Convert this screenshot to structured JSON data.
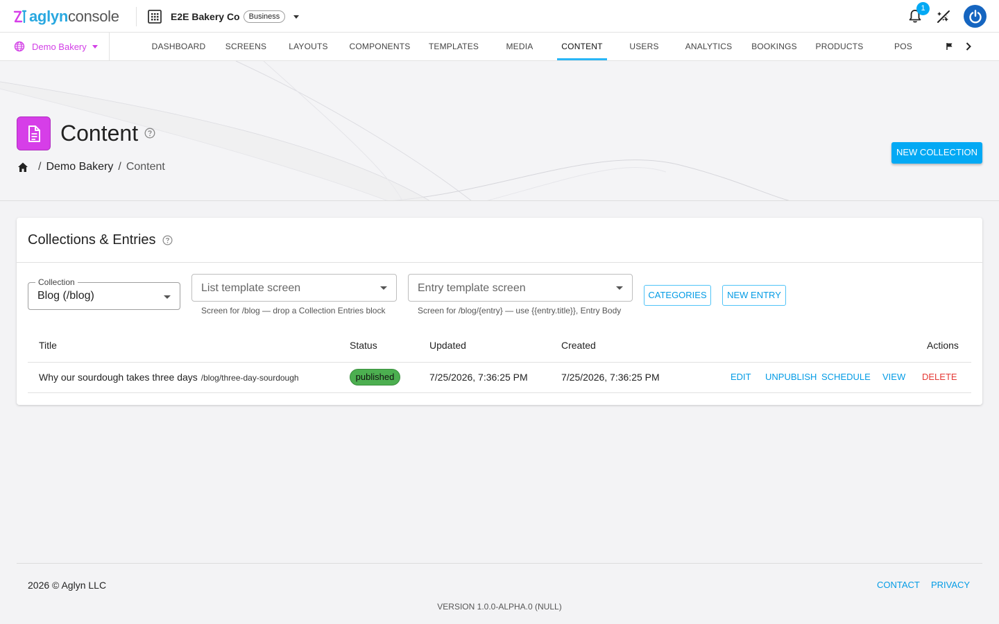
{
  "topbar": {
    "logo_brand": "aglyn",
    "logo_product": "console",
    "org_name": "E2E Bakery Co",
    "org_plan": "Business",
    "notification_count": "1"
  },
  "nav": {
    "site_name": "Demo Bakery",
    "tabs": [
      {
        "label": "DASHBOARD"
      },
      {
        "label": "SCREENS"
      },
      {
        "label": "LAYOUTS"
      },
      {
        "label": "COMPONENTS"
      },
      {
        "label": "TEMPLATES"
      },
      {
        "label": "MEDIA"
      },
      {
        "label": "CONTENT",
        "active": true
      },
      {
        "label": "USERS"
      },
      {
        "label": "ANALYTICS"
      },
      {
        "label": "BOOKINGS"
      },
      {
        "label": "PRODUCTS"
      },
      {
        "label": "POS"
      }
    ]
  },
  "header": {
    "title": "Content",
    "breadcrumb": [
      "Demo Bakery",
      "Content"
    ],
    "new_collection_label": "NEW COLLECTION",
    "icon_color": "#d63ee8"
  },
  "card": {
    "title": "Collections & Entries",
    "collection_field": {
      "label": "Collection",
      "value": "Blog (/blog)"
    },
    "list_template": {
      "placeholder": "List template screen",
      "helper": "Screen for /blog — drop a Collection Entries block"
    },
    "entry_template": {
      "placeholder": "Entry template screen",
      "helper": "Screen for /blog/{entry} — use {{entry.title}}, Entry Body"
    },
    "categories_label": "CATEGORIES",
    "new_entry_label": "NEW ENTRY",
    "columns": [
      "Title",
      "Status",
      "Updated",
      "Created",
      "Actions"
    ],
    "rows": [
      {
        "title": "Why our sourdough takes three days",
        "slug": "/blog/three-day-sourdough",
        "status": "published",
        "updated": "7/25/2026, 7:36:25 PM",
        "created": "7/25/2026, 7:36:25 PM",
        "actions": [
          "EDIT",
          "UNPUBLISH",
          "SCHEDULE",
          "VIEW",
          "DELETE"
        ]
      }
    ]
  },
  "footer": {
    "copyright": "2026 © Aglyn LLC",
    "links": [
      "CONTACT",
      "PRIVACY"
    ],
    "version": "VERSION 1.0.0-ALPHA.0 (NULL)"
  },
  "colors": {
    "accent": "#03a9f4",
    "site": "#d23fe6",
    "published": "#4caf50",
    "danger": "#e53935"
  }
}
